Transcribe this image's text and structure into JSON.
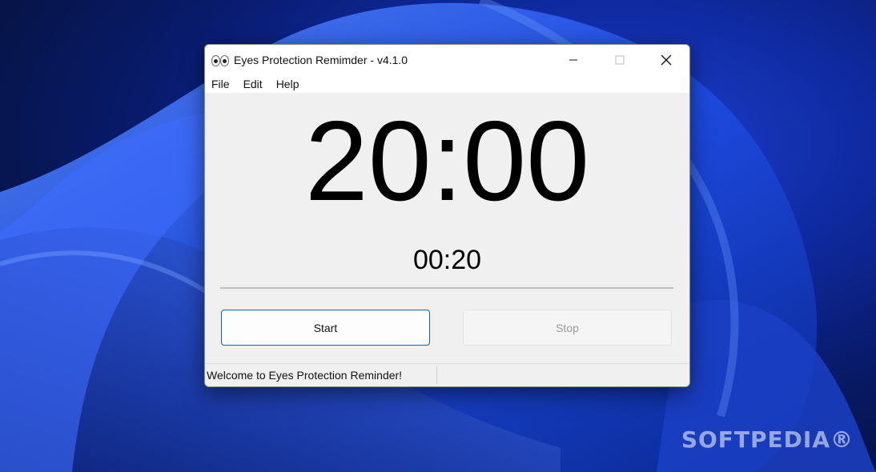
{
  "window": {
    "title": "Eyes Protection Remimder - v4.1.0",
    "icon": "eyes-icon"
  },
  "menu": [
    "File",
    "Edit",
    "Help"
  ],
  "timer": {
    "main": "20:00",
    "break": "00:20",
    "progress": 0
  },
  "buttons": {
    "start": "Start",
    "stop": "Stop"
  },
  "status": {
    "message": "Welcome to Eyes Protection Reminder!"
  },
  "watermark": "SOFTPEDIA®",
  "colors": {
    "accent": "#0067c0",
    "progress_track": "#bcbcbc"
  }
}
